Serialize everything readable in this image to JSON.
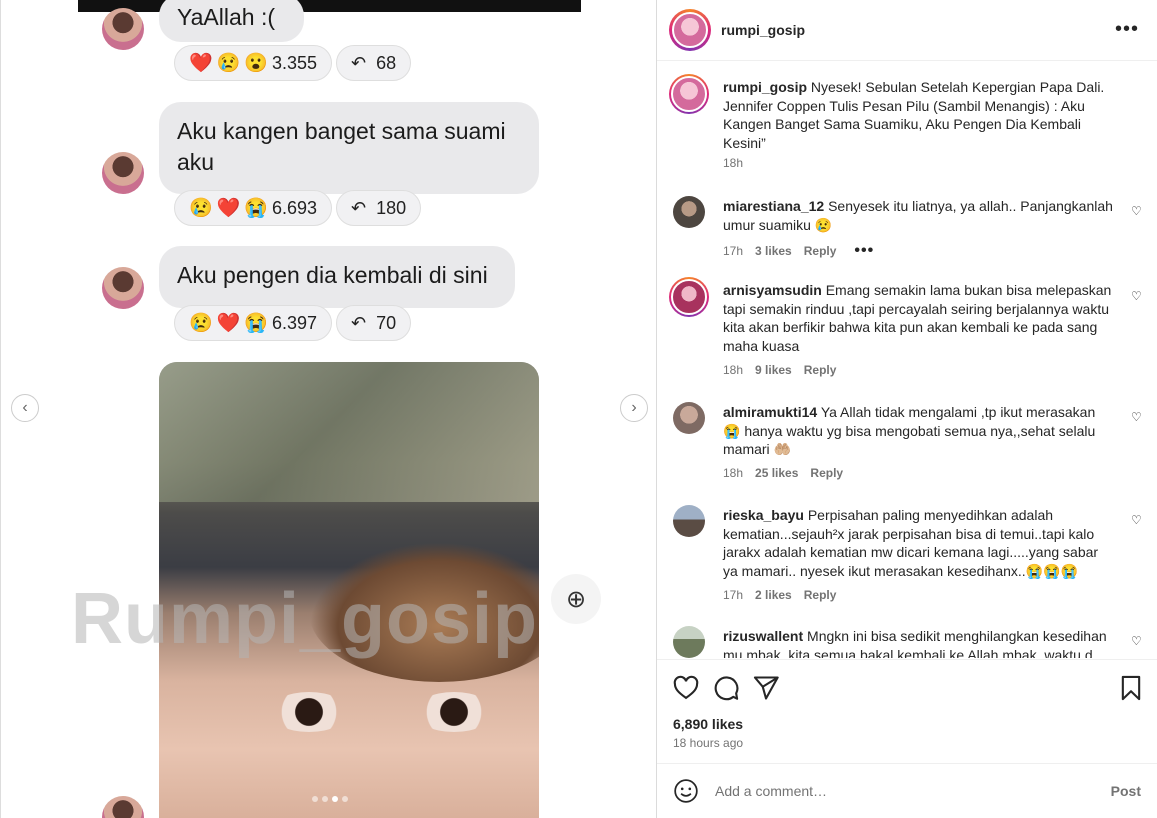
{
  "chat": {
    "msg1": {
      "text": "YaAllah :(",
      "reactions": [
        "❤️",
        "😢",
        "😮"
      ],
      "count": "3.355",
      "replies": "68"
    },
    "msg2": {
      "text": "Aku kangen banget sama suami aku",
      "reactions": [
        "😢",
        "❤️",
        "😭"
      ],
      "count": "6.693",
      "replies": "180"
    },
    "msg3": {
      "text": "Aku pengen dia kembali di sini",
      "reactions": [
        "😢",
        "❤️",
        "😭"
      ],
      "count": "6.397",
      "replies": "70"
    }
  },
  "watermark": "Rumpi_gosip",
  "carousel": {
    "slides": 4,
    "active": 2
  },
  "header": {
    "username": "rumpi_gosip"
  },
  "caption": {
    "username": "rumpi_gosip",
    "text": "Nyesek! Sebulan Setelah Kepergian Papa Dali. Jennifer Coppen Tulis Pesan Pilu (Sambil Menangis) : Aku Kangen Banget Sama Suamiku, Aku Pengen Dia Kembali Kesini”",
    "time": "18h"
  },
  "comments": [
    {
      "username": "miarestiana_12",
      "text": "Senyesek itu liatnya, ya allah.. Panjangkanlah umur suamiku 😢",
      "time": "17h",
      "likes": "3 likes",
      "reply": "Reply",
      "more": "•••",
      "avatar_color": "#6b6258"
    },
    {
      "username": "arnisyamsudin",
      "text": "Emang semakin lama bukan bisa melepaskan tapi semakin rinduu ,tapi percayalah seiring berjalannya waktu kita akan berfikir bahwa kita pun akan kembali ke pada sang maha kuasa",
      "time": "18h",
      "likes": "9 likes",
      "reply": "Reply",
      "avatar_color": "#c4406f"
    },
    {
      "username": "almiramukti14",
      "text": "Ya Allah tidak mengalami ,tp ikut merasakan 😭 hanya waktu yg bisa mengobati semua nya,,sehat selalu mamari 🤲🏼",
      "time": "18h",
      "likes": "25 likes",
      "reply": "Reply",
      "avatar_color": "#9a7f74"
    },
    {
      "username": "rieska_bayu",
      "text": "Perpisahan paling menyedihkan adalah kematian...sejauh²x jarak perpisahan bisa di temui..tapi kalo jarakx adalah kematian mw dicari kemana lagi.....yang sabar ya mamari.. nyesek ikut merasakan kesedihanx..😭😭😭",
      "time": "17h",
      "likes": "2 likes",
      "reply": "Reply",
      "avatar_color": "#6f7a88"
    },
    {
      "username": "rizuswallent",
      "text": "Mngkn ini bisa sedikit menghilangkan kesedihan mu mbak. kita semua bakal kembali ke Allah mbak. waktu d",
      "avatar_color": "#8a9a7e"
    }
  ],
  "stats": {
    "likes": "6,890 likes",
    "ago": "18 hours ago"
  },
  "composer": {
    "placeholder": "Add a comment…",
    "post": "Post",
    "emoji_icon": "smiley-icon"
  },
  "colors": {
    "ig_gradient_start": "#f58529",
    "ig_gradient_mid": "#dd2a7b",
    "bubble": "#e9e9eb",
    "muted": "#737373"
  }
}
